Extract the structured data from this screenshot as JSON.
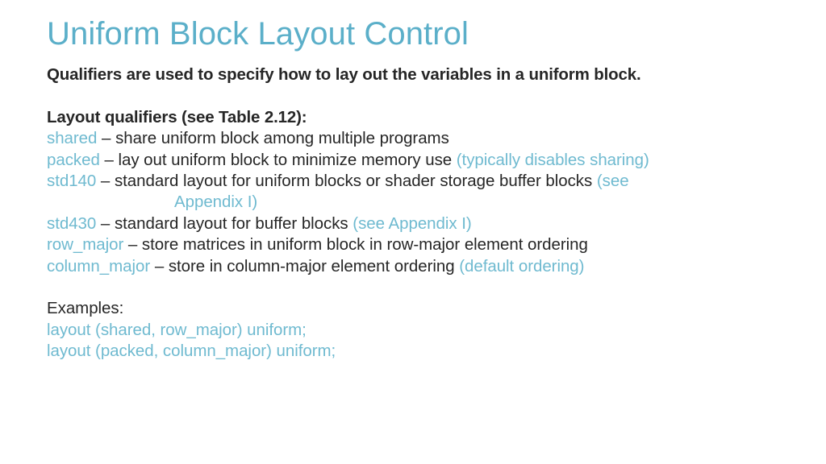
{
  "slide": {
    "title": "Uniform Block Layout Control",
    "intro": "Qualifiers are used to specify how to lay out the variables in a uniform block.",
    "section_heading": "Layout qualifiers (see Table 2.12):",
    "dash": "–",
    "qualifiers": [
      {
        "keyword": "shared",
        "description": "share uniform block among multiple programs",
        "note": ""
      },
      {
        "keyword": "packed",
        "description": "lay out uniform block to minimize memory use",
        "note": "(typically disables sharing)"
      },
      {
        "keyword": "std140",
        "description": "standard layout for uniform blocks or shader storage buffer blocks",
        "note": "(see",
        "note_continued": "Appendix I)"
      },
      {
        "keyword": "std430",
        "description": "standard layout for buffer blocks",
        "note": "(see Appendix I)"
      },
      {
        "keyword": "row_major",
        "description": "store matrices in uniform block in row-major element ordering",
        "note": ""
      },
      {
        "keyword": "column_major",
        "description": "store in column-major element ordering",
        "note": "(default ordering)"
      }
    ],
    "examples_heading": "Examples:",
    "examples": [
      "layout (shared, row_major) uniform;",
      "layout (packed, column_major) uniform;"
    ]
  },
  "colors": {
    "title_teal": "#5BAFC9",
    "body_teal": "#6FBAD0",
    "body_dark": "#262626",
    "background": "#FFFFFF"
  }
}
